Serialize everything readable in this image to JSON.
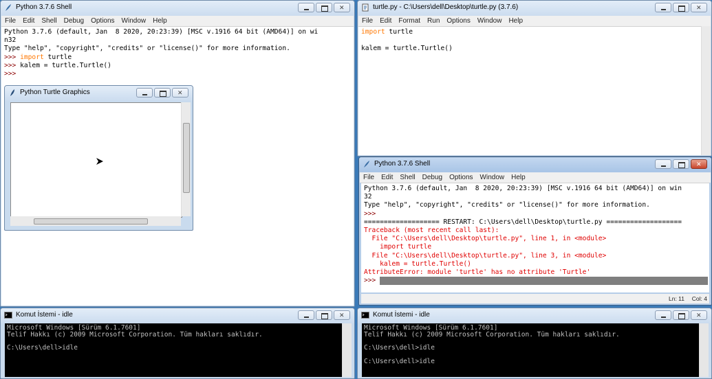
{
  "shell_left": {
    "title": "Python 3.7.6 Shell",
    "menu": [
      "File",
      "Edit",
      "Shell",
      "Debug",
      "Options",
      "Window",
      "Help"
    ],
    "lines": [
      {
        "t": "Python 3.7.6 (default, Jan  8 2020, 20:23:39) [MSC v.1916 64 bit (AMD64)] on wi"
      },
      {
        "t": "n32"
      },
      {
        "t": "Type \"help\", \"copyright\", \"credits\" or \"license()\" for more information."
      },
      {
        "p": ">>> ",
        "k": "import",
        "t": " turtle"
      },
      {
        "p": ">>> ",
        "t": "kalem = turtle.Turtle()"
      },
      {
        "p": ">>> ",
        "t": ""
      }
    ]
  },
  "turtle_gfx": {
    "title": "Python Turtle Graphics"
  },
  "editor": {
    "title": "turtle.py - C:\\Users\\dell\\Desktop\\turtle.py (3.7.6)",
    "menu": [
      "File",
      "Edit",
      "Format",
      "Run",
      "Options",
      "Window",
      "Help"
    ],
    "lines": [
      {
        "k": "import",
        "t": " turtle"
      },
      {
        "t": ""
      },
      {
        "t": "kalem = turtle.Turtle()"
      }
    ]
  },
  "shell_right": {
    "title": "Python 3.7.6 Shell",
    "menu": [
      "File",
      "Edit",
      "Shell",
      "Debug",
      "Options",
      "Window",
      "Help"
    ],
    "lines": [
      {
        "t": "Python 3.7.6 (default, Jan  8 2020, 20:23:39) [MSC v.1916 64 bit (AMD64)] on win"
      },
      {
        "t": "32"
      },
      {
        "t": "Type \"help\", \"copyright\", \"credits\" or \"license()\" for more information."
      },
      {
        "p": ">>> ",
        "t": ""
      },
      {
        "t": "=================== RESTART: C:\\Users\\dell\\Desktop\\turtle.py ==================="
      },
      {
        "e": "Traceback (most recent call last):"
      },
      {
        "e": "  File \"C:\\Users\\dell\\Desktop\\turtle.py\", line 1, in <module>"
      },
      {
        "e": "    import turtle"
      },
      {
        "e": "  File \"C:\\Users\\dell\\Desktop\\turtle.py\", line 3, in <module>"
      },
      {
        "e": "    kalem = turtle.Turtle()"
      },
      {
        "e": "AttributeError: module 'turtle' has no attribute 'Turtle'"
      }
    ],
    "prompt": ">>> ",
    "status_ln": "Ln: 11",
    "status_col": "Col: 4"
  },
  "cmd_left": {
    "title": "Komut İstemi - idle",
    "lines": [
      "Microsoft Windows [Sürüm 6.1.7601]",
      "Telif Hakkı (c) 2009 Microsoft Corporation. Tüm hakları saklıdır.",
      "",
      "C:\\Users\\dell>idle"
    ]
  },
  "cmd_right": {
    "title": "Komut İstemi - idle",
    "lines": [
      "Microsoft Windows [Sürüm 6.1.7601]",
      "Telif Hakkı (c) 2009 Microsoft Corporation. Tüm hakları saklıdır.",
      "",
      "C:\\Users\\dell>idle",
      "",
      "C:\\Users\\dell>idle"
    ]
  }
}
